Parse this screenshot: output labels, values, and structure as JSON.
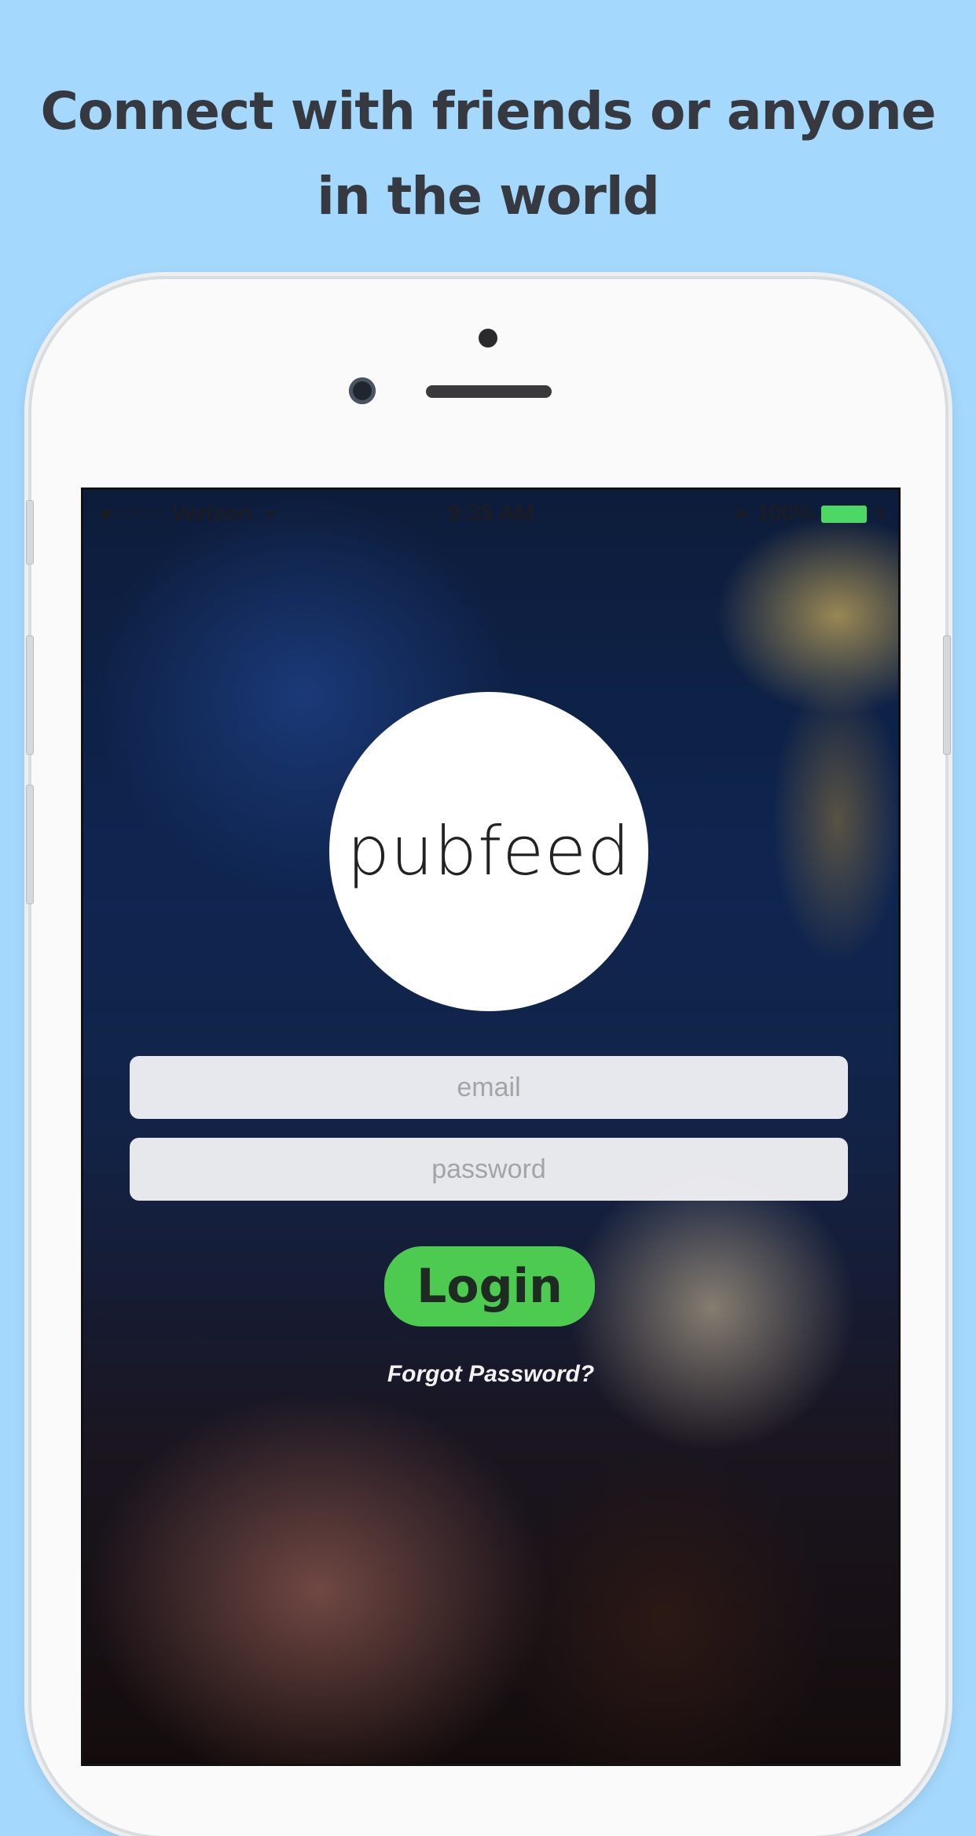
{
  "headline": {
    "line1": "Connect with friends or anyone",
    "line2": "in the world"
  },
  "status_bar": {
    "signal": "●○○○○",
    "carrier": "Verizon",
    "wifi_icon": "wifi-icon",
    "time": "9:35 AM",
    "location_icon": "location-arrow-icon",
    "battery_percent": "100%",
    "battery_color": "#4bd964"
  },
  "logo": {
    "text": "pubfeed"
  },
  "form": {
    "email_placeholder": "email",
    "password_placeholder": "password",
    "login_label": "Login",
    "forgot_label": "Forgot Password?"
  },
  "colors": {
    "background": "#a4d8fc",
    "login_button": "#4ccb50",
    "headline_text": "#363a40"
  }
}
